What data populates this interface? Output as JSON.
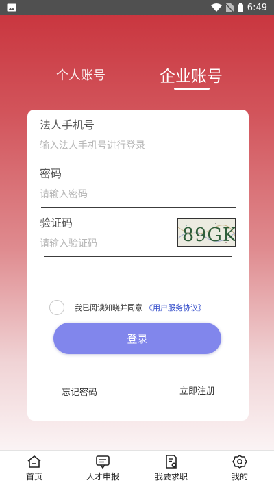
{
  "status_bar": {
    "time": "6:49",
    "icons": [
      "image-icon",
      "wifi-icon",
      "no-sim-icon",
      "battery-icon"
    ]
  },
  "tabs": {
    "personal": "个人账号",
    "enterprise": "企业账号",
    "active": "enterprise"
  },
  "form": {
    "phone_label": "法人手机号",
    "phone_placeholder": "输入法人手机号进行登录",
    "password_label": "密码",
    "password_placeholder": "请输入密码",
    "captcha_label": "验证码",
    "captcha_placeholder": "请输入验证码",
    "captcha_text": "89GK"
  },
  "agreement": {
    "text": "我已阅读知晓并同意",
    "link": "《用户服务协议》"
  },
  "login_button": "登录",
  "links": {
    "forgot": "忘记密码",
    "register": "立即注册"
  },
  "bottom_nav": {
    "home": "首页",
    "talent": "人才申报",
    "job": "我要求职",
    "mine": "我的"
  },
  "colors": {
    "gradient_top": "#c8323b",
    "button": "#8186ec",
    "link": "#2f49c9"
  }
}
